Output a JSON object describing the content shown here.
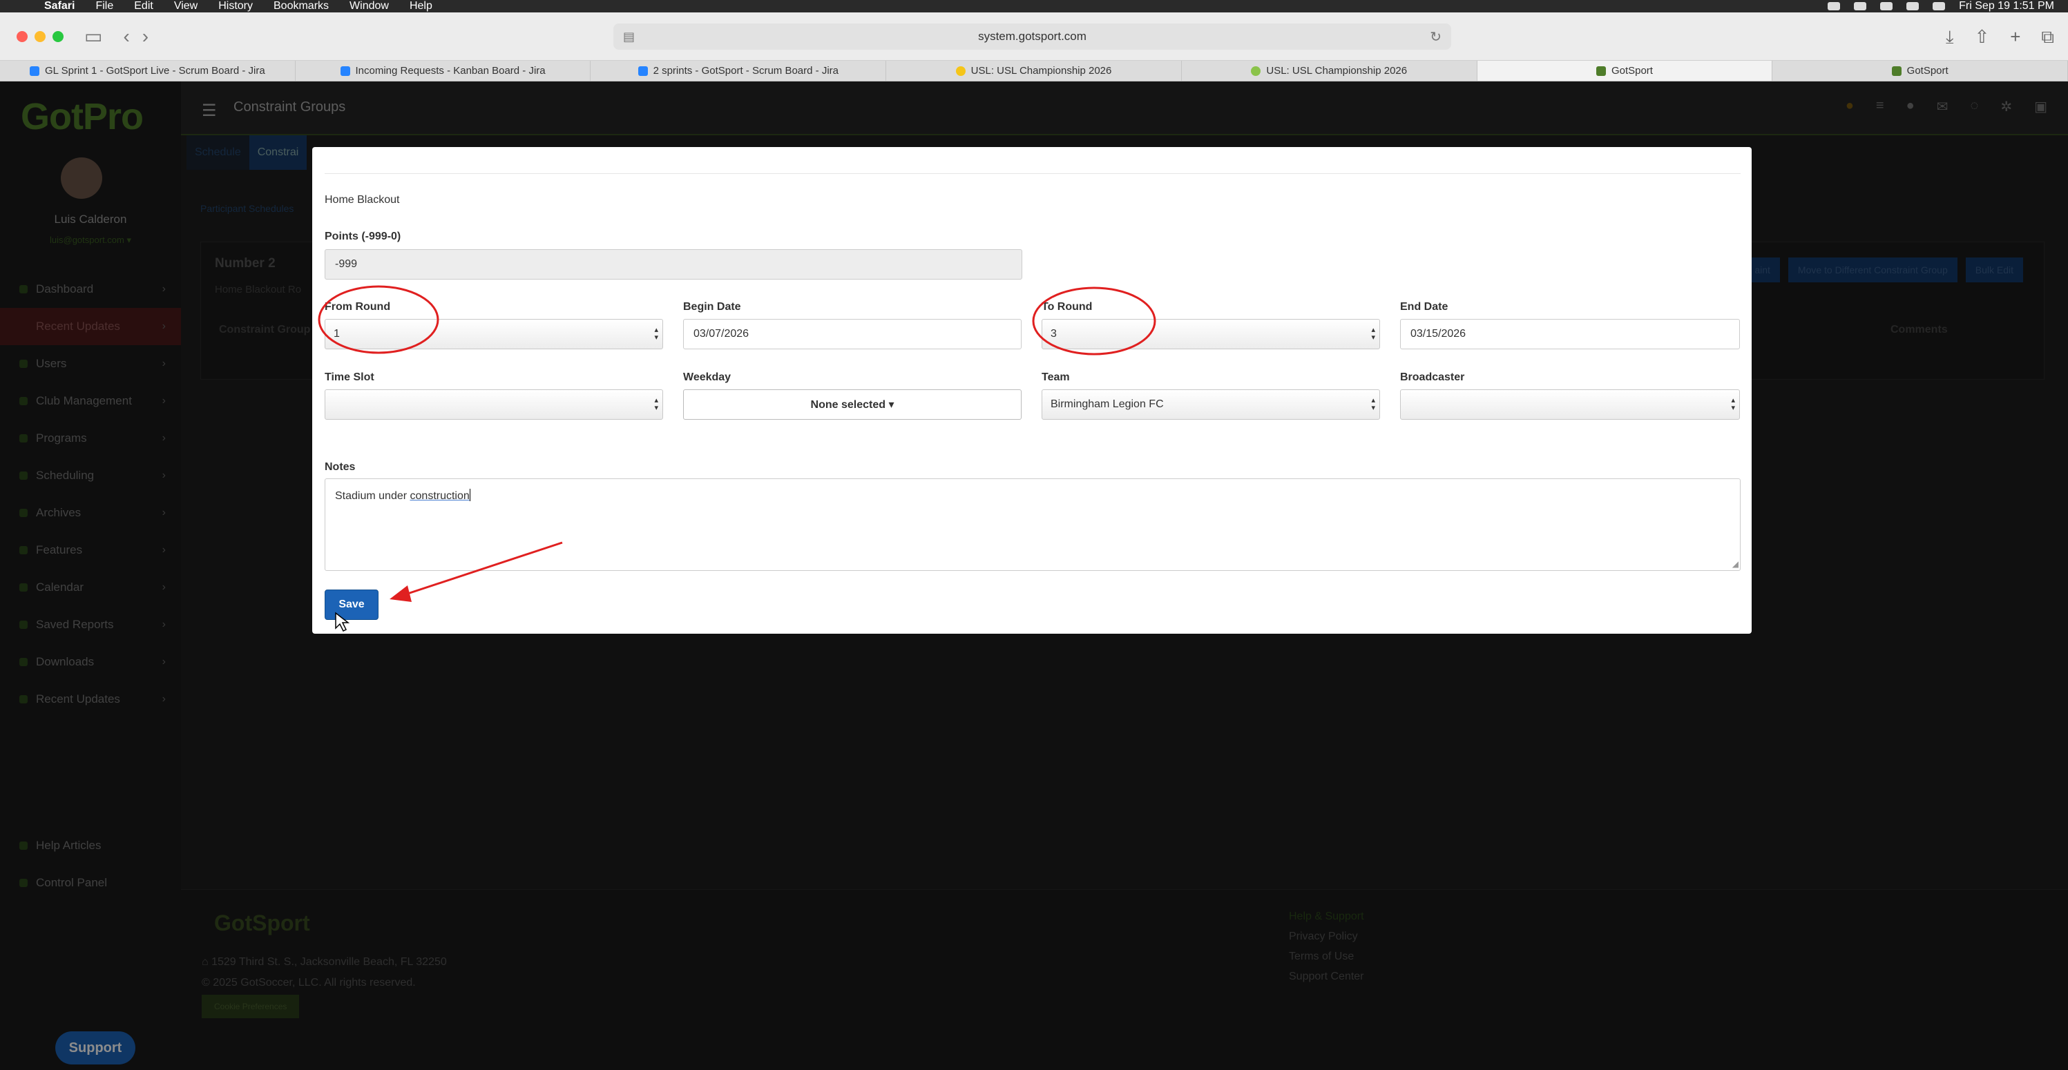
{
  "menubar": {
    "app": "Safari",
    "items": [
      "File",
      "Edit",
      "View",
      "History",
      "Bookmarks",
      "Window",
      "Help"
    ],
    "clock": "Fri Sep 19  1:51 PM"
  },
  "browser": {
    "url": "system.gotsport.com",
    "tabs": [
      {
        "label": "GL Sprint 1 - GotSport Live - Scrum Board - Jira",
        "color": "#2684ff"
      },
      {
        "label": "Incoming Requests - Kanban Board - Jira",
        "color": "#2684ff"
      },
      {
        "label": "2 sprints - GotSport - Scrum Board - Jira",
        "color": "#2684ff"
      },
      {
        "label": "USL: USL Championship 2026",
        "color": "#f5c518"
      },
      {
        "label": "USL: USL Championship 2026",
        "color": "#8bc34a"
      },
      {
        "label": "GotSport",
        "color": "#4f7d2a"
      },
      {
        "label": "GotSport",
        "color": "#4f7d2a"
      }
    ]
  },
  "sidebar": {
    "logo": "GotPro",
    "user_name": "Luis Calderon",
    "user_email": "luis@gotsport.com ▾",
    "items": [
      {
        "label": "Dashboard"
      },
      {
        "label": "Recent Updates"
      },
      {
        "label": "Users"
      },
      {
        "label": "Club Management"
      },
      {
        "label": "Programs"
      },
      {
        "label": "Scheduling"
      },
      {
        "label": "Archives"
      },
      {
        "label": "Features"
      },
      {
        "label": "Calendar"
      },
      {
        "label": "Saved Reports"
      },
      {
        "label": "Downloads"
      },
      {
        "label": "Recent Updates"
      }
    ],
    "secondary": [
      {
        "label": "Help Articles"
      },
      {
        "label": "Control Panel"
      }
    ],
    "support": "Support"
  },
  "header": {
    "title": "Constraint Groups"
  },
  "subnav": {
    "tabs": [
      "Schedule",
      "Constrai"
    ]
  },
  "breadcrumb": "Participant Schedules",
  "card": {
    "title": "Number 2",
    "subtitle": "Home Blackout Ro",
    "buttons": [
      "aint",
      "Move to Different Constraint Group",
      "Bulk Edit"
    ],
    "col_left": "Constraint Group",
    "col_right": "Comments"
  },
  "footer": {
    "logo": "GotSport",
    "address": "1529 Third St. S., Jacksonville Beach, FL 32250",
    "copyright": "© 2025 GotSoccer, LLC. All rights reserved.",
    "cookie": "Cookie Preferences",
    "links": [
      "Help & Support",
      "Privacy Policy",
      "Terms of Use",
      "Support Center"
    ]
  },
  "modal": {
    "section_title": "Home Blackout",
    "points": {
      "label": "Points (-999-0)",
      "value": "-999"
    },
    "from_round": {
      "label": "From Round",
      "value": "1"
    },
    "begin_date": {
      "label": "Begin Date",
      "value": "03/07/2026"
    },
    "to_round": {
      "label": "To Round",
      "value": "3"
    },
    "end_date": {
      "label": "End Date",
      "value": "03/15/2026"
    },
    "time_slot": {
      "label": "Time Slot",
      "value": ""
    },
    "weekday": {
      "label": "Weekday",
      "value": "None selected ▾"
    },
    "team": {
      "label": "Team",
      "value": "Birmingham Legion FC"
    },
    "broadcaster": {
      "label": "Broadcaster",
      "value": ""
    },
    "notes": {
      "label": "Notes",
      "value_prefix": "Stadium under ",
      "value_underlined": "construction"
    },
    "save_label": "Save"
  },
  "annotation_color": "#e02020"
}
